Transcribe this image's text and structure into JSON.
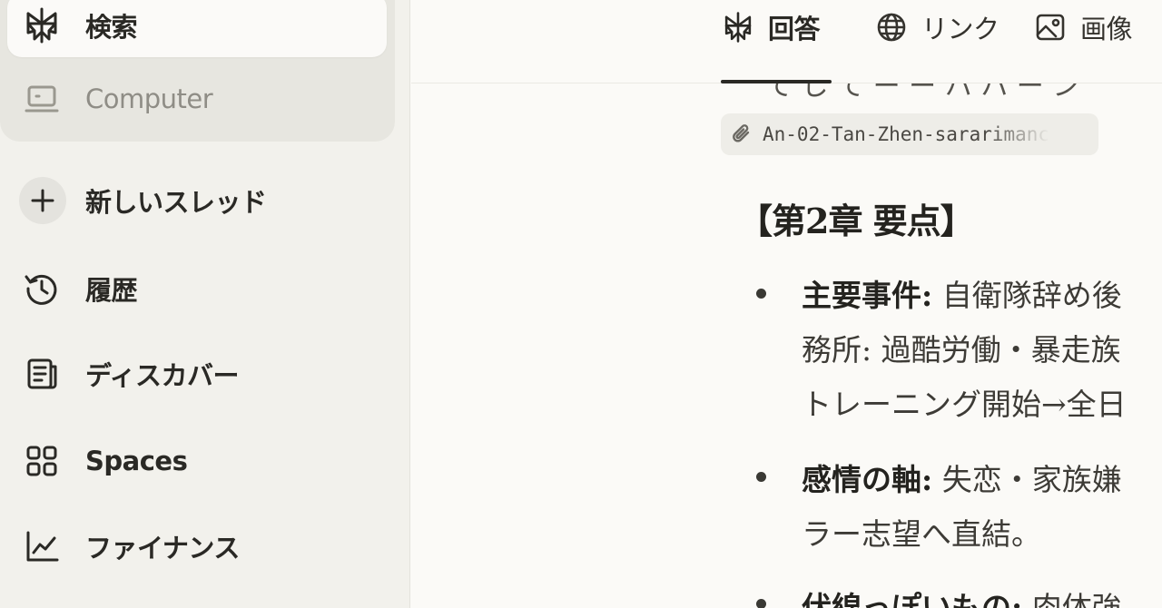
{
  "sidebar": {
    "items": [
      {
        "label": "検索",
        "icon": "perplexity-logo-icon"
      },
      {
        "label": "Computer",
        "icon": "monitor-icon"
      },
      {
        "label": "新しいスレッド",
        "icon": "plus-icon"
      },
      {
        "label": "履歴",
        "icon": "history-icon"
      },
      {
        "label": "ディスカバー",
        "icon": "newspaper-icon"
      },
      {
        "label": "Spaces",
        "icon": "grid-icon"
      },
      {
        "label": "ファイナンス",
        "icon": "chart-line-icon"
      }
    ]
  },
  "main": {
    "tabs": [
      {
        "label": "回答",
        "icon": "perplexity-logo-icon",
        "active": true
      },
      {
        "label": "リンク",
        "icon": "globe-icon",
        "active": false
      },
      {
        "label": "画像",
        "icon": "image-icon",
        "active": false
      }
    ],
    "cutoff_text": "て し て ー ー ハ ハ ー ン",
    "attachment": {
      "filename": "An-02-Tan-Zhen-sararimanc",
      "icon": "paperclip-icon"
    },
    "heading": "【第2章 要点】",
    "bullets": [
      {
        "label": "主要事件:",
        "lines": [
          "自衛隊辞め後",
          "務所: 過酷労働・暴走族",
          "トレーニング開始→全日"
        ]
      },
      {
        "label": "感情の軸:",
        "lines": [
          "失恋・家族嫌",
          "ラー志望へ直結。"
        ]
      },
      {
        "label": "伏線っぽいもの:",
        "lines": [
          "肉体強"
        ]
      }
    ]
  },
  "colors": {
    "sidebar_bg": "#f2f1ec",
    "main_bg": "#fbfaf7",
    "active_item_bg": "#fbfaf8",
    "text": "#24231f",
    "muted_text": "#8f8d86"
  }
}
